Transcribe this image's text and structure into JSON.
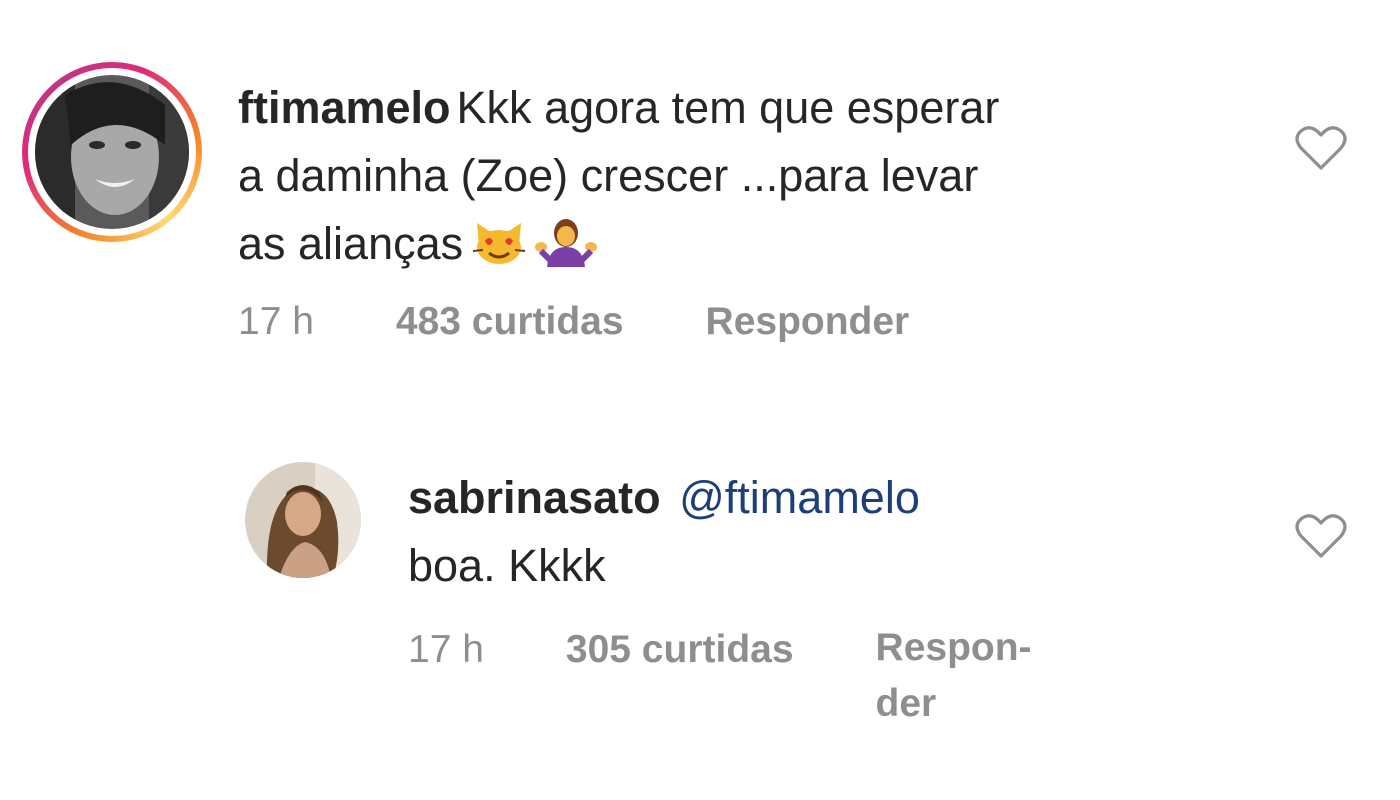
{
  "comments": [
    {
      "username": "ftimamelo",
      "text_line1": "Kkk agora tem que esperar",
      "text_line2": "a daminha (Zoe) crescer ...para levar",
      "text_line3": "as alianças",
      "emojis": [
        "heart-eyes-cat-emoji",
        "woman-shrugging-emoji"
      ],
      "time": "17 h",
      "likes": "483 curtidas",
      "reply": "Responder",
      "has_story_ring": true
    },
    {
      "username": "sabrinasato",
      "mention": "@ftimamelo",
      "text": "boa. Kkkk",
      "time": "17 h",
      "likes": "305 curtidas",
      "reply_part1": "Respon-",
      "reply_part2": "der",
      "has_story_ring": false
    }
  ],
  "colors": {
    "text": "#262626",
    "meta": "#8e8e8e",
    "mention": "#1c3f7a",
    "ring_start": "#f58529",
    "ring_end": "#dd2a7b"
  }
}
